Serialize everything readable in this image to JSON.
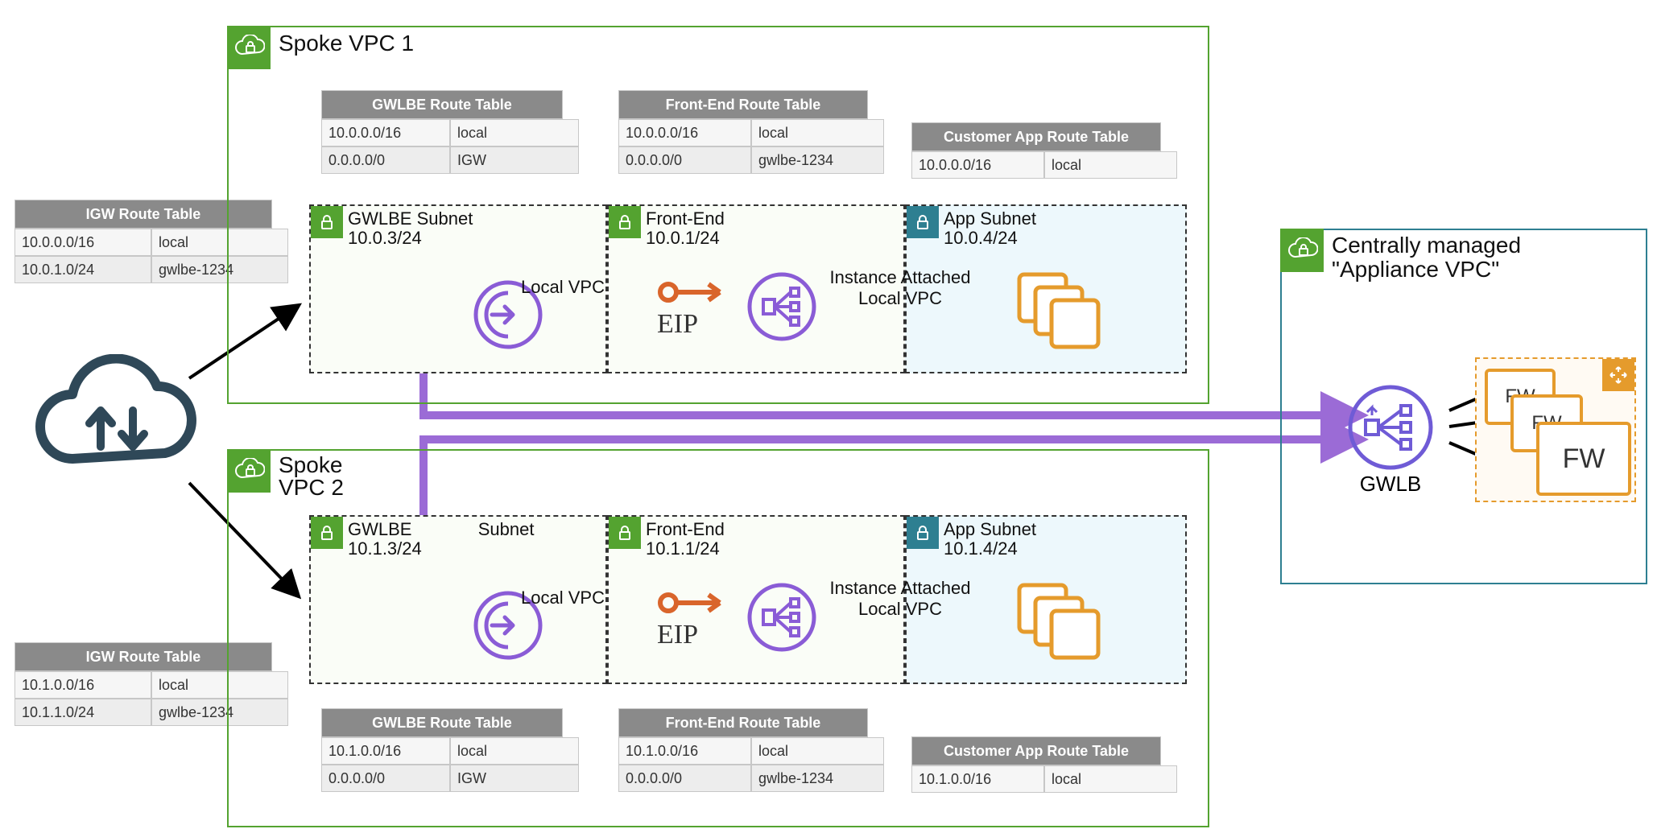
{
  "cloud_igw": {
    "label": ""
  },
  "spoke1": {
    "title": "Spoke VPC 1",
    "gwlbe_rt": {
      "title": "GWLBE Route Table",
      "rows": [
        {
          "dest": "10.0.0.0/16",
          "target": "local"
        },
        {
          "dest": "0.0.0.0/0",
          "target": "IGW"
        }
      ]
    },
    "fe_rt": {
      "title": "Front-End Route Table",
      "rows": [
        {
          "dest": "10.0.0.0/16",
          "target": "local"
        },
        {
          "dest": "0.0.0.0/0",
          "target": "gwlbe-1234"
        }
      ]
    },
    "app_rt": {
      "title": "Customer App Route Table",
      "rows": [
        {
          "dest": "10.0.0.0/16",
          "target": "local"
        }
      ]
    },
    "subnet_gwlbe": {
      "name": "GWLBE Subnet",
      "cidr": "10.0.3/24"
    },
    "subnet_fe": {
      "name": "Front-End",
      "cidr": "10.0.1/24"
    },
    "subnet_app": {
      "name": "App Subnet",
      "cidr": "10.0.4/24"
    },
    "arrow1_label": "Local VPC",
    "arrow2_label": "Instance Attached\nLocal VPC",
    "eip_label": "EIP"
  },
  "spoke2": {
    "title": "Spoke\nVPC 2",
    "gwlbe_rt": {
      "title": "GWLBE Route Table",
      "rows": [
        {
          "dest": "10.1.0.0/16",
          "target": "local"
        },
        {
          "dest": "0.0.0.0/0",
          "target": "IGW"
        }
      ]
    },
    "fe_rt": {
      "title": "Front-End Route Table",
      "rows": [
        {
          "dest": "10.1.0.0/16",
          "target": "local"
        },
        {
          "dest": "0.0.0.0/0",
          "target": "gwlbe-1234"
        }
      ]
    },
    "app_rt": {
      "title": "Customer App Route Table",
      "rows": [
        {
          "dest": "10.1.0.0/16",
          "target": "local"
        }
      ]
    },
    "subnet_gwlbe": {
      "name": "GWLBE",
      "name2": "Subnet",
      "cidr": "10.1.3/24"
    },
    "subnet_fe": {
      "name": "Front-End",
      "cidr": "10.1.1/24"
    },
    "subnet_app": {
      "name": "App Subnet",
      "cidr": "10.1.4/24"
    },
    "arrow1_label": "Local VPC",
    "arrow2_label": "Instance Attached\nLocal VPC",
    "eip_label": "EIP"
  },
  "igw_rt_1": {
    "title": "IGW Route Table",
    "rows": [
      {
        "dest": "10.0.0.0/16",
        "target": "local"
      },
      {
        "dest": "10.0.1.0/24",
        "target": "gwlbe-1234"
      }
    ]
  },
  "igw_rt_2": {
    "title": "IGW Route Table",
    "rows": [
      {
        "dest": "10.1.0.0/16",
        "target": "local"
      },
      {
        "dest": "10.1.1.0/24",
        "target": "gwlbe-1234"
      }
    ]
  },
  "appliance_vpc": {
    "title": "Centrally managed\n\"Appliance VPC\"",
    "gwlb_label": "GWLB",
    "fw_label": "FW"
  }
}
